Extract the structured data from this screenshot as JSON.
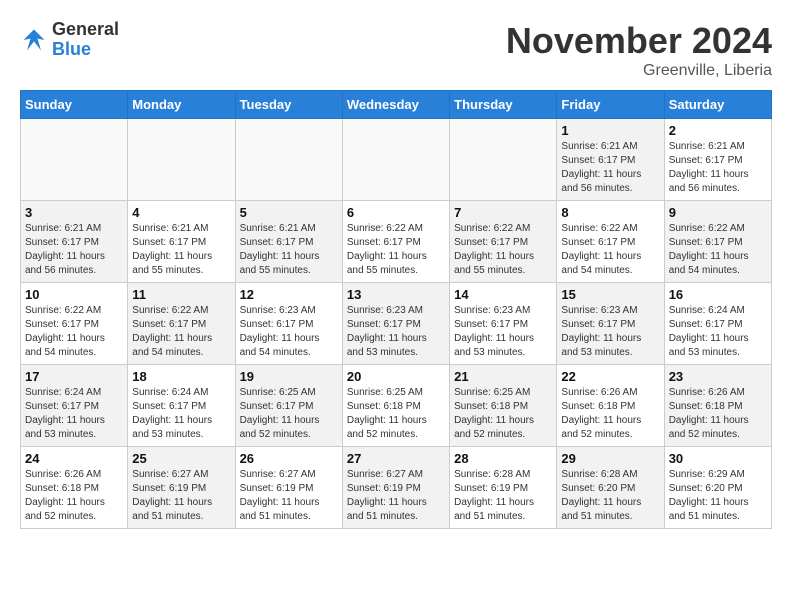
{
  "logo": {
    "general": "General",
    "blue": "Blue"
  },
  "title": "November 2024",
  "subtitle": "Greenville, Liberia",
  "days_of_week": [
    "Sunday",
    "Monday",
    "Tuesday",
    "Wednesday",
    "Thursday",
    "Friday",
    "Saturday"
  ],
  "weeks": [
    [
      {
        "day": "",
        "info": "",
        "empty": true
      },
      {
        "day": "",
        "info": "",
        "empty": true
      },
      {
        "day": "",
        "info": "",
        "empty": true
      },
      {
        "day": "",
        "info": "",
        "empty": true
      },
      {
        "day": "",
        "info": "",
        "empty": true
      },
      {
        "day": "1",
        "info": "Sunrise: 6:21 AM\nSunset: 6:17 PM\nDaylight: 11 hours\nand 56 minutes.",
        "shaded": true
      },
      {
        "day": "2",
        "info": "Sunrise: 6:21 AM\nSunset: 6:17 PM\nDaylight: 11 hours\nand 56 minutes.",
        "shaded": false
      }
    ],
    [
      {
        "day": "3",
        "info": "Sunrise: 6:21 AM\nSunset: 6:17 PM\nDaylight: 11 hours\nand 56 minutes.",
        "shaded": true
      },
      {
        "day": "4",
        "info": "Sunrise: 6:21 AM\nSunset: 6:17 PM\nDaylight: 11 hours\nand 55 minutes.",
        "shaded": false
      },
      {
        "day": "5",
        "info": "Sunrise: 6:21 AM\nSunset: 6:17 PM\nDaylight: 11 hours\nand 55 minutes.",
        "shaded": true
      },
      {
        "day": "6",
        "info": "Sunrise: 6:22 AM\nSunset: 6:17 PM\nDaylight: 11 hours\nand 55 minutes.",
        "shaded": false
      },
      {
        "day": "7",
        "info": "Sunrise: 6:22 AM\nSunset: 6:17 PM\nDaylight: 11 hours\nand 55 minutes.",
        "shaded": true
      },
      {
        "day": "8",
        "info": "Sunrise: 6:22 AM\nSunset: 6:17 PM\nDaylight: 11 hours\nand 54 minutes.",
        "shaded": false
      },
      {
        "day": "9",
        "info": "Sunrise: 6:22 AM\nSunset: 6:17 PM\nDaylight: 11 hours\nand 54 minutes.",
        "shaded": true
      }
    ],
    [
      {
        "day": "10",
        "info": "Sunrise: 6:22 AM\nSunset: 6:17 PM\nDaylight: 11 hours\nand 54 minutes.",
        "shaded": false
      },
      {
        "day": "11",
        "info": "Sunrise: 6:22 AM\nSunset: 6:17 PM\nDaylight: 11 hours\nand 54 minutes.",
        "shaded": true
      },
      {
        "day": "12",
        "info": "Sunrise: 6:23 AM\nSunset: 6:17 PM\nDaylight: 11 hours\nand 54 minutes.",
        "shaded": false
      },
      {
        "day": "13",
        "info": "Sunrise: 6:23 AM\nSunset: 6:17 PM\nDaylight: 11 hours\nand 53 minutes.",
        "shaded": true
      },
      {
        "day": "14",
        "info": "Sunrise: 6:23 AM\nSunset: 6:17 PM\nDaylight: 11 hours\nand 53 minutes.",
        "shaded": false
      },
      {
        "day": "15",
        "info": "Sunrise: 6:23 AM\nSunset: 6:17 PM\nDaylight: 11 hours\nand 53 minutes.",
        "shaded": true
      },
      {
        "day": "16",
        "info": "Sunrise: 6:24 AM\nSunset: 6:17 PM\nDaylight: 11 hours\nand 53 minutes.",
        "shaded": false
      }
    ],
    [
      {
        "day": "17",
        "info": "Sunrise: 6:24 AM\nSunset: 6:17 PM\nDaylight: 11 hours\nand 53 minutes.",
        "shaded": true
      },
      {
        "day": "18",
        "info": "Sunrise: 6:24 AM\nSunset: 6:17 PM\nDaylight: 11 hours\nand 53 minutes.",
        "shaded": false
      },
      {
        "day": "19",
        "info": "Sunrise: 6:25 AM\nSunset: 6:17 PM\nDaylight: 11 hours\nand 52 minutes.",
        "shaded": true
      },
      {
        "day": "20",
        "info": "Sunrise: 6:25 AM\nSunset: 6:18 PM\nDaylight: 11 hours\nand 52 minutes.",
        "shaded": false
      },
      {
        "day": "21",
        "info": "Sunrise: 6:25 AM\nSunset: 6:18 PM\nDaylight: 11 hours\nand 52 minutes.",
        "shaded": true
      },
      {
        "day": "22",
        "info": "Sunrise: 6:26 AM\nSunset: 6:18 PM\nDaylight: 11 hours\nand 52 minutes.",
        "shaded": false
      },
      {
        "day": "23",
        "info": "Sunrise: 6:26 AM\nSunset: 6:18 PM\nDaylight: 11 hours\nand 52 minutes.",
        "shaded": true
      }
    ],
    [
      {
        "day": "24",
        "info": "Sunrise: 6:26 AM\nSunset: 6:18 PM\nDaylight: 11 hours\nand 52 minutes.",
        "shaded": false
      },
      {
        "day": "25",
        "info": "Sunrise: 6:27 AM\nSunset: 6:19 PM\nDaylight: 11 hours\nand 51 minutes.",
        "shaded": true
      },
      {
        "day": "26",
        "info": "Sunrise: 6:27 AM\nSunset: 6:19 PM\nDaylight: 11 hours\nand 51 minutes.",
        "shaded": false
      },
      {
        "day": "27",
        "info": "Sunrise: 6:27 AM\nSunset: 6:19 PM\nDaylight: 11 hours\nand 51 minutes.",
        "shaded": true
      },
      {
        "day": "28",
        "info": "Sunrise: 6:28 AM\nSunset: 6:19 PM\nDaylight: 11 hours\nand 51 minutes.",
        "shaded": false
      },
      {
        "day": "29",
        "info": "Sunrise: 6:28 AM\nSunset: 6:20 PM\nDaylight: 11 hours\nand 51 minutes.",
        "shaded": true
      },
      {
        "day": "30",
        "info": "Sunrise: 6:29 AM\nSunset: 6:20 PM\nDaylight: 11 hours\nand 51 minutes.",
        "shaded": false
      }
    ]
  ]
}
